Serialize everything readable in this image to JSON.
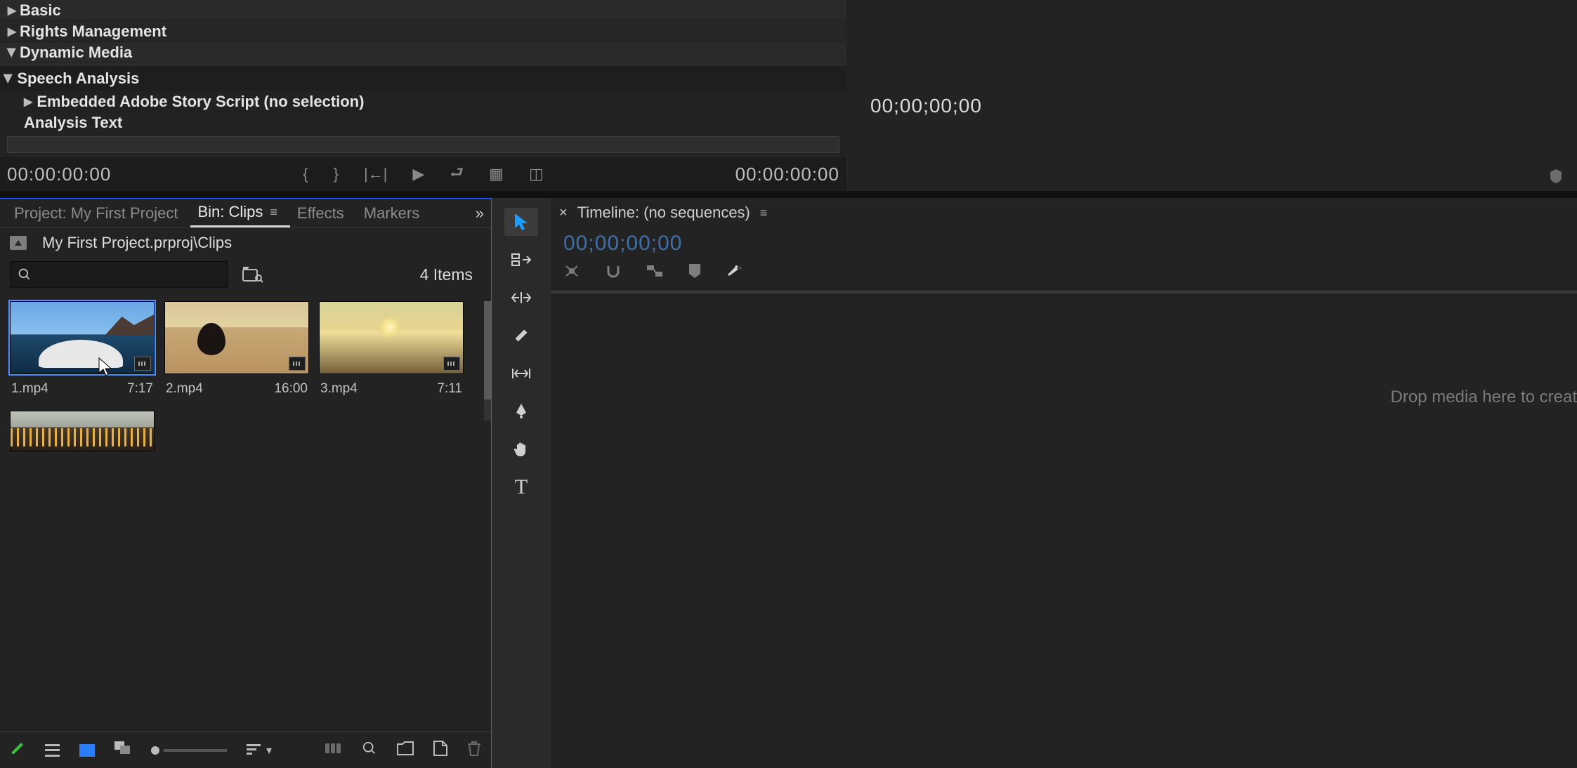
{
  "metadata_panel": {
    "basic": "Basic",
    "rights": "Rights Management",
    "dynamic": "Dynamic Media",
    "speech": "Speech Analysis",
    "embedded": "Embedded Adobe Story Script (no selection)",
    "analysis_text": "Analysis Text"
  },
  "source_monitor": {
    "tc_left": "00:00:00:00",
    "tc_right": "00:00:00:00",
    "tc_program": "00;00;00;00"
  },
  "project_panel": {
    "tab_project": "Project: My First Project",
    "tab_bin": "Bin: Clips",
    "tab_effects": "Effects",
    "tab_markers": "Markers",
    "breadcrumb": "My First Project.prproj\\Clips",
    "search_placeholder": "",
    "item_count": "4 Items",
    "clips": [
      {
        "name": "1.mp4",
        "duration": "7:17"
      },
      {
        "name": "2.mp4",
        "duration": "16:00"
      },
      {
        "name": "3.mp4",
        "duration": "7:11"
      },
      {
        "name": "",
        "duration": ""
      }
    ]
  },
  "timeline": {
    "title": "Timeline: (no sequences)",
    "tc": "00;00;00;00",
    "drop_hint": "Drop media here to creat"
  }
}
